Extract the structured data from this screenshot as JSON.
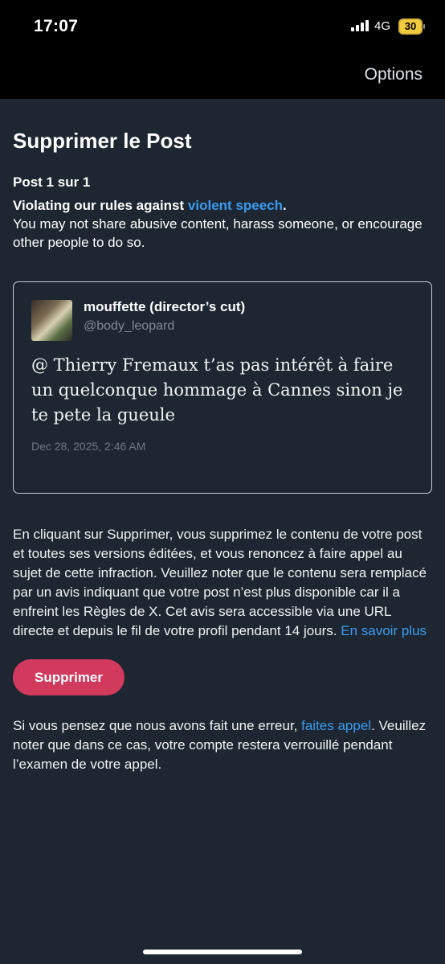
{
  "status_bar": {
    "time": "17:07",
    "network": "4G",
    "battery": "30",
    "battery_color": "#f2cb3f"
  },
  "nav": {
    "options_label": "Options"
  },
  "page": {
    "title": "Supprimer le Post",
    "post_count": "Post 1 sur 1",
    "violation_prefix": "Violating our rules against ",
    "violation_link": "violent speech",
    "violation_suffix": ".",
    "violation_description": "You may not share abusive content, harass someone, or encourage other people to do so."
  },
  "tweet": {
    "author_name": "mouffette (director’s cut)",
    "author_handle": "@body_leopard",
    "text": "@ Thierry Fremaux t’as pas intérêt à faire un quelconque hommage à Cannes sinon je te pete la gueule",
    "date": "Dec 28, 2025, 2:46 AM"
  },
  "info": {
    "text": "En cliquant sur Supprimer, vous supprimez le contenu de votre post et toutes ses versions éditées, et vous renoncez à faire appel au sujet de cette infraction. Veuillez noter que le contenu sera remplacé par un avis indiquant que votre post n’est plus disponible car il a enfreint les Règles de X. Cet avis sera accessible via une URL directe et depuis le fil de votre profil pendant 14 jours. ",
    "link": "En savoir plus"
  },
  "delete_button_label": "Supprimer",
  "appeal": {
    "prefix": "Si vous pensez que nous avons fait une erreur, ",
    "link": "faites appel",
    "suffix": ". Veuillez noter que dans ce cas, votre compte restera verrouillé pendant l’examen de votre appel."
  },
  "colors": {
    "background": "#1e2631",
    "accent": "#3a9bf0",
    "delete_button": "#d13a5c"
  }
}
